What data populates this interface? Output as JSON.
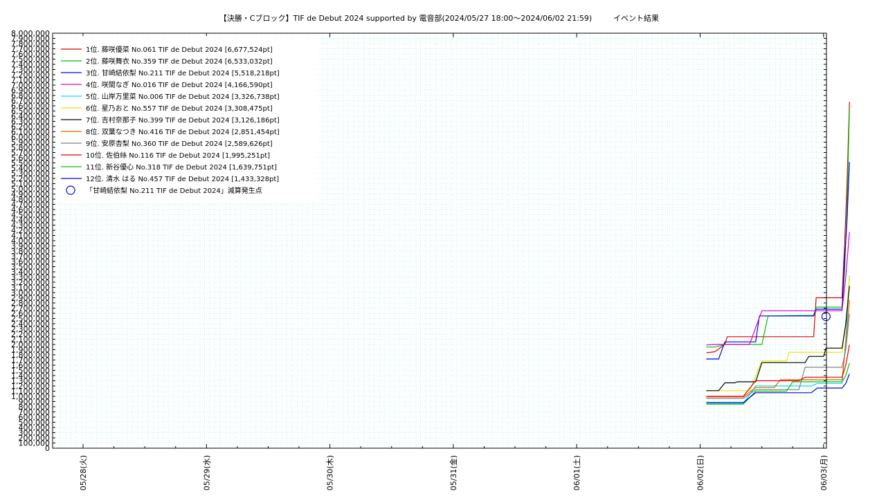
{
  "chart_data": {
    "type": "line",
    "title": "【決勝・Cブロック】TIF de Debut 2024 supported by 電音部(2024/05/27 18:00～2024/06/02 21:59)",
    "subtitle": "イベント結果",
    "xlabel": "",
    "ylabel": "",
    "ylim": [
      0,
      8000000
    ],
    "y_ticks": [
      "8,000,000",
      "7,900,000",
      "7,800,000",
      "7,700,000",
      "7,600,000",
      "7,500,000",
      "7,400,000",
      "7,300,000",
      "7,200,000",
      "7,100,000",
      "7,000,000",
      "6,900,000",
      "6,800,000",
      "6,700,000",
      "6,600,000",
      "6,500,000",
      "6,400,000",
      "6,300,000",
      "6,200,000",
      "6,100,000",
      "6,000,000",
      "5,900,000",
      "5,800,000",
      "5,700,000",
      "5,600,000",
      "5,500,000",
      "5,400,000",
      "5,300,000",
      "5,200,000",
      "5,100,000",
      "5,000,000",
      "4,900,000",
      "4,800,000",
      "4,700,000",
      "4,600,000",
      "4,500,000",
      "4,400,000",
      "4,300,000",
      "4,200,000",
      "4,100,000",
      "4,000,000",
      "3,900,000",
      "3,800,000",
      "3,700,000",
      "3,600,000",
      "3,500,000",
      "3,400,000",
      "3,300,000",
      "3,200,000",
      "3,100,000",
      "3,000,000",
      "2,900,000",
      "2,800,000",
      "2,700,000",
      "2,600,000",
      "2,500,000",
      "2,400,000",
      "2,300,000",
      "2,200,000",
      "2,100,000",
      "2,000,000",
      "1,900,000",
      "1,800,000",
      "1,700,000",
      "1,600,000",
      "1,500,000",
      "1,400,000",
      "1,300,000",
      "1,200,000",
      "1,100,000",
      "1,000,000",
      "900,000",
      "800,000",
      "700,000",
      "600,000",
      "500,000",
      "400,000",
      "300,000",
      "200,000",
      "100,000",
      "0"
    ],
    "x_ticks": [
      "05/28(火)",
      "05/29(水)",
      "05/30(木)",
      "05/31(金)",
      "06/01(土)",
      "06/02(日)",
      "06/03(月)"
    ],
    "grid": true,
    "legend_position": "top-left",
    "series": [
      {
        "name": "1位. 藤咲優菜 No.061 TIF de Debut 2024 [6,677,524pt]",
        "color": "#e00000",
        "points": [
          [
            5.05,
            1840000
          ],
          [
            5.12,
            1860000
          ],
          [
            5.2,
            2000000
          ],
          [
            5.22,
            2150000
          ],
          [
            5.65,
            2150000
          ],
          [
            5.92,
            2150000
          ],
          [
            5.94,
            2900000
          ],
          [
            6.15,
            2900000
          ],
          [
            6.17,
            3900000
          ],
          [
            6.19,
            5100000
          ],
          [
            6.21,
            6677524
          ]
        ]
      },
      {
        "name": "2位. 藤咲舞衣 No.359 TIF de Debut 2024 [6,533,032pt]",
        "color": "#00c000",
        "points": [
          [
            5.05,
            1950000
          ],
          [
            5.12,
            1950000
          ],
          [
            5.2,
            2000000
          ],
          [
            5.5,
            2000000
          ],
          [
            5.55,
            2550000
          ],
          [
            5.92,
            2560000
          ],
          [
            5.94,
            2720000
          ],
          [
            6.15,
            2720000
          ],
          [
            6.17,
            3400000
          ],
          [
            6.19,
            4600000
          ],
          [
            6.21,
            6533032
          ]
        ]
      },
      {
        "name": "3位. 甘崎結依梨 No.211 TIF de Debut 2024 [5,518,218pt]",
        "color": "#0000e0",
        "points": [
          [
            5.05,
            1720000
          ],
          [
            5.15,
            1720000
          ],
          [
            5.2,
            2050000
          ],
          [
            5.45,
            2050000
          ],
          [
            5.48,
            2550000
          ],
          [
            5.92,
            2550000
          ],
          [
            5.94,
            2680000
          ],
          [
            6.15,
            2680000
          ],
          [
            6.17,
            3600000
          ],
          [
            6.19,
            4400000
          ],
          [
            6.21,
            5518218
          ]
        ]
      },
      {
        "name": "4位. 咲間なぎ No.016 TIF de Debut 2024 [4,166,590pt]",
        "color": "#d000d0",
        "points": [
          [
            5.05,
            1990000
          ],
          [
            5.12,
            2000000
          ],
          [
            5.4,
            2000000
          ],
          [
            5.5,
            2650000
          ],
          [
            6.15,
            2650000
          ],
          [
            6.18,
            3300000
          ],
          [
            6.21,
            4166590
          ]
        ]
      },
      {
        "name": "5位. 山岸万里菜 No.006 TIF de Debut 2024 [3,326,738pt]",
        "color": "#00e0e0",
        "points": [
          [
            5.05,
            860000
          ],
          [
            5.35,
            860000
          ],
          [
            5.45,
            1200000
          ],
          [
            5.9,
            1200000
          ],
          [
            5.95,
            1250000
          ],
          [
            6.15,
            1250000
          ],
          [
            6.18,
            2100000
          ],
          [
            6.21,
            3326738
          ]
        ]
      },
      {
        "name": "6位. 星乃おと No.557 TIF de Debut 2024 [3,308,475pt]",
        "color": "#e8e800",
        "points": [
          [
            5.05,
            1110000
          ],
          [
            5.4,
            1110000
          ],
          [
            5.5,
            1680000
          ],
          [
            5.7,
            1680000
          ],
          [
            5.72,
            1850000
          ],
          [
            6.15,
            1850000
          ],
          [
            6.18,
            2400000
          ],
          [
            6.21,
            3308475
          ]
        ]
      },
      {
        "name": "7位. 吉村奈那子 No.399 TIF de Debut 2024 [3,126,186pt]",
        "color": "#000000",
        "points": [
          [
            5.05,
            1110000
          ],
          [
            5.15,
            1110000
          ],
          [
            5.2,
            1260000
          ],
          [
            5.28,
            1260000
          ],
          [
            5.3,
            1280000
          ],
          [
            5.45,
            1280000
          ],
          [
            5.5,
            1650000
          ],
          [
            5.85,
            1650000
          ],
          [
            5.88,
            1770000
          ],
          [
            6.0,
            1770000
          ],
          [
            6.02,
            1930000
          ],
          [
            6.15,
            1930000
          ],
          [
            6.18,
            2400000
          ],
          [
            6.21,
            3126186
          ]
        ]
      },
      {
        "name": "8位. 双葉なつき No.416 TIF de Debut 2024 [2,851,454pt]",
        "color": "#e06000",
        "points": [
          [
            5.05,
            990000
          ],
          [
            5.35,
            990000
          ],
          [
            5.45,
            1170000
          ],
          [
            5.6,
            1170000
          ],
          [
            5.65,
            1320000
          ],
          [
            6.15,
            1320000
          ],
          [
            6.18,
            2000000
          ],
          [
            6.21,
            2851454
          ]
        ]
      },
      {
        "name": "9位. 安原杏梨 No.360 TIF de Debut 2024 [2,589,626pt]",
        "color": "#808080",
        "points": [
          [
            5.05,
            960000
          ],
          [
            5.35,
            960000
          ],
          [
            5.45,
            1130000
          ],
          [
            5.8,
            1130000
          ],
          [
            5.85,
            1560000
          ],
          [
            6.15,
            1560000
          ],
          [
            6.18,
            1900000
          ],
          [
            6.21,
            2589626
          ]
        ]
      },
      {
        "name": "10位. 佐伯絲 No.116 TIF de Debut 2024 [1,995,251pt]",
        "color": "#e00000",
        "points": [
          [
            5.05,
            1000000
          ],
          [
            5.35,
            1000000
          ],
          [
            5.45,
            1300000
          ],
          [
            5.8,
            1300000
          ],
          [
            5.85,
            1370000
          ],
          [
            6.15,
            1370000
          ],
          [
            6.18,
            1600000
          ],
          [
            6.21,
            1995251
          ]
        ]
      },
      {
        "name": "11位. 新谷優心 No.318 TIF de Debut 2024 [1,639,751pt]",
        "color": "#00c000",
        "points": [
          [
            5.05,
            850000
          ],
          [
            5.35,
            850000
          ],
          [
            5.45,
            1100000
          ],
          [
            5.7,
            1100000
          ],
          [
            5.75,
            1280000
          ],
          [
            6.15,
            1280000
          ],
          [
            6.18,
            1400000
          ],
          [
            6.21,
            1639751
          ]
        ]
      },
      {
        "name": "12位. 清水 はる No.457 TIF de Debut 2024 [1,433,328pt]",
        "color": "#0000e0",
        "points": [
          [
            5.05,
            880000
          ],
          [
            5.35,
            880000
          ],
          [
            5.45,
            1070000
          ],
          [
            5.9,
            1070000
          ],
          [
            5.95,
            1160000
          ],
          [
            6.15,
            1160000
          ],
          [
            6.18,
            1250000
          ],
          [
            6.21,
            1433328
          ]
        ]
      }
    ],
    "markers": [
      {
        "name": "「甘崎結依梨 No.211 TIF de Debut 2024」減算発生点",
        "color": "#0000e0",
        "x": 6.02,
        "y": 2540000
      }
    ]
  }
}
